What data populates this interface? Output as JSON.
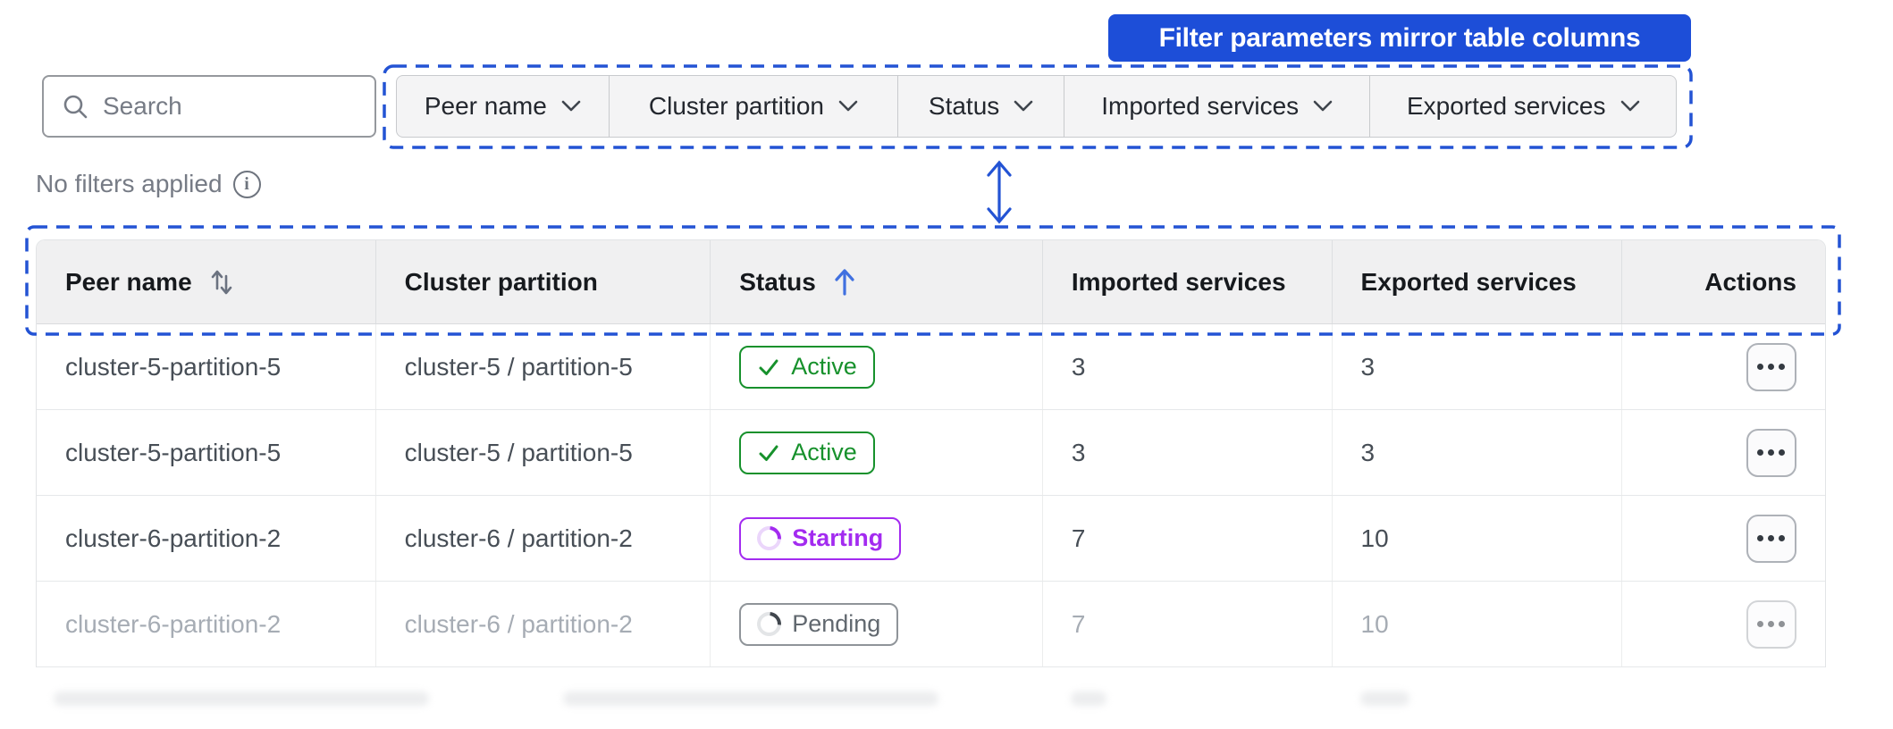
{
  "callout": {
    "label": "Filter parameters mirror table columns"
  },
  "search": {
    "placeholder": "Search"
  },
  "filters": {
    "status_text": "No filters applied",
    "items": [
      {
        "label": "Peer name"
      },
      {
        "label": "Cluster partition"
      },
      {
        "label": "Status"
      },
      {
        "label": "Imported services"
      },
      {
        "label": "Exported services"
      }
    ]
  },
  "table": {
    "columns": [
      {
        "label": "Peer name",
        "sort": "both"
      },
      {
        "label": "Cluster partition",
        "sort": null
      },
      {
        "label": "Status",
        "sort": "asc"
      },
      {
        "label": "Imported services",
        "sort": null
      },
      {
        "label": "Exported services",
        "sort": null
      },
      {
        "label": "Actions",
        "sort": null
      }
    ],
    "rows": [
      {
        "peer_name": "cluster-5-partition-5",
        "cluster_partition": "cluster-5 / partition-5",
        "status": "Active",
        "status_kind": "active",
        "imported": "3",
        "exported": "3",
        "muted": false
      },
      {
        "peer_name": "cluster-5-partition-5",
        "cluster_partition": "cluster-5 / partition-5",
        "status": "Active",
        "status_kind": "active",
        "imported": "3",
        "exported": "3",
        "muted": false
      },
      {
        "peer_name": "cluster-6-partition-2",
        "cluster_partition": "cluster-6 / partition-2",
        "status": "Starting",
        "status_kind": "starting",
        "imported": "7",
        "exported": "10",
        "muted": false
      },
      {
        "peer_name": "cluster-6-partition-2",
        "cluster_partition": "cluster-6 / partition-2",
        "status": "Pending",
        "status_kind": "pending",
        "imported": "7",
        "exported": "10",
        "muted": true
      }
    ]
  },
  "colors": {
    "accent_blue": "#1d4ed8",
    "annotation_blue": "#2353d4",
    "sort_arrow_blue": "#4070e0",
    "active_green": "#17912c",
    "starting_purple": "#a32bf0",
    "pending_gray": "#8f9499"
  }
}
